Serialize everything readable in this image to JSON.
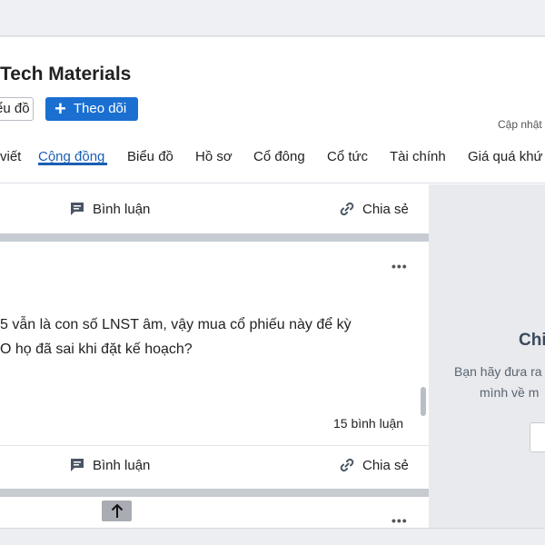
{
  "header": {
    "company_title": "Tech Materials",
    "chart_button": "ểu đồ",
    "follow_button": "Theo dõi",
    "updated_label": "Cập nhật"
  },
  "tabs": [
    {
      "label": "viết"
    },
    {
      "label": "Cộng đồng",
      "active": true
    },
    {
      "label": "Biểu đồ"
    },
    {
      "label": "Hồ sơ"
    },
    {
      "label": "Cổ đông"
    },
    {
      "label": "Cổ tức"
    },
    {
      "label": "Tài chính"
    },
    {
      "label": "Giá quá khứ"
    }
  ],
  "feed": {
    "actions_top": {
      "comment": "Bình luận",
      "share": "Chia sẻ"
    },
    "post": {
      "more": "•••",
      "line1": "5 vẫn là con số LNST âm, vậy mua cổ phiếu này để kỳ",
      "line2": "O họ đã sai khi đặt kế hoạch?",
      "comments": "15 bình luận"
    },
    "actions_bottom": {
      "comment": "Bình luận",
      "share": "Chia sẻ"
    },
    "next_more": "•••",
    "up_icon": "arrow-up-icon"
  },
  "sidebar": {
    "title": "Chi",
    "line1": "Bạn hãy đưa ra",
    "line2": "mình về m"
  },
  "colors": {
    "accent": "#1a5fb4",
    "follow_bg": "#1a6fd1",
    "sidebar_bg": "#e8eaed"
  }
}
